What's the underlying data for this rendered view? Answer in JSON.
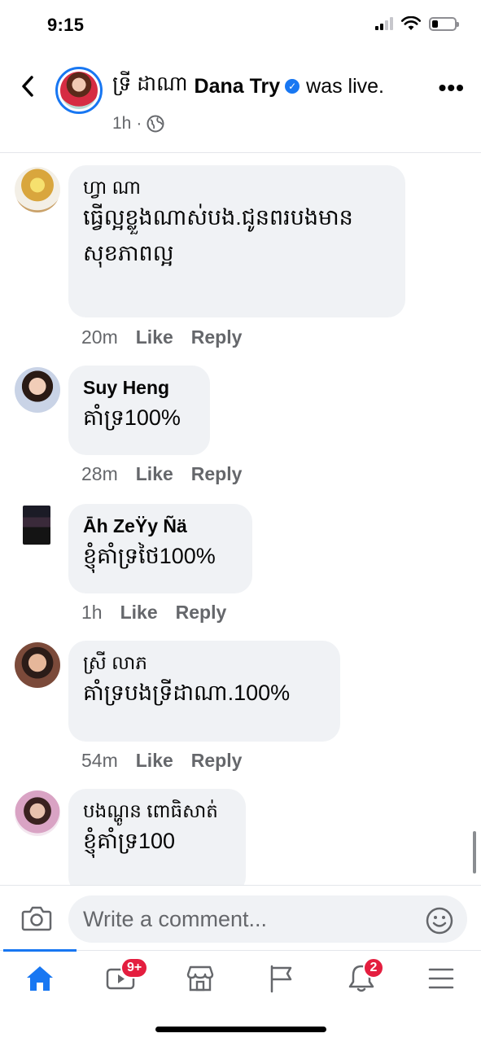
{
  "status_bar": {
    "time": "9:15"
  },
  "header": {
    "author_kh": "ទ្រី ដាណា",
    "author_en": "Dana Try",
    "action": "was live.",
    "time": "1h",
    "separator": "·",
    "accent_color": "#1877f2"
  },
  "comments": [
    {
      "author": "ហ្វា ណា",
      "lines": [
        "ធ្វើល្អខ្លួងណាស់បង.ជូនពរបងមាន",
        "សុខភាពល្អ"
      ],
      "time": "20m",
      "like": "Like",
      "reply": "Reply"
    },
    {
      "author": "Suy Heng",
      "lines": [
        "គាំទ្រ100%"
      ],
      "time": "28m",
      "like": "Like",
      "reply": "Reply"
    },
    {
      "author": "Āh ZeŸy Ñä",
      "lines": [
        "ខ្ញុំគាំទ្រថៃ100%"
      ],
      "time": "1h",
      "like": "Like",
      "reply": "Reply"
    },
    {
      "author": "ស្រី លាភ",
      "lines": [
        "គាំទ្របងទ្រីដាណា.100%"
      ],
      "time": "54m",
      "like": "Like",
      "reply": "Reply"
    },
    {
      "author": "បងណ្ហូន ពោធិសាត់",
      "lines": [
        "ខ្ញុំគាំទ្រ100"
      ],
      "time": "",
      "like": "",
      "reply": ""
    }
  ],
  "composer": {
    "placeholder": "Write a comment..."
  },
  "tabbar": {
    "items": [
      {
        "icon": "home-icon",
        "active": true
      },
      {
        "icon": "watch-icon",
        "badge": "9+"
      },
      {
        "icon": "marketplace-icon"
      },
      {
        "icon": "pages-flag-icon"
      },
      {
        "icon": "notifications-bell-icon",
        "badge": "2"
      },
      {
        "icon": "menu-icon"
      }
    ]
  },
  "colors": {
    "bubble": "#f0f2f5",
    "secondary_text": "#65676b",
    "badge": "#e41e3f"
  }
}
